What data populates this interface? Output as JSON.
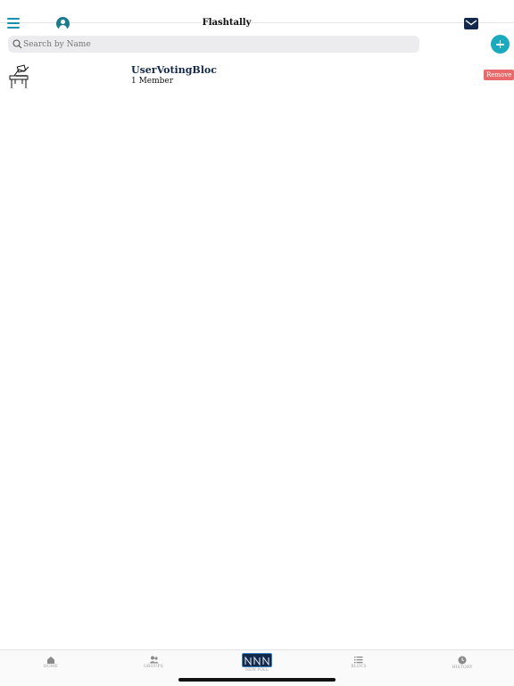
{
  "header": {
    "title": "Flashtally",
    "menu_icon": "hamburger-menu-icon",
    "profile_icon": "profile-icon",
    "mail_icon": "envelope-icon",
    "accent_color": "#1a8fb0",
    "navy_color": "#13294b"
  },
  "search": {
    "placeholder": "Search by Name",
    "value": ""
  },
  "add_button": {
    "icon": "plus-icon",
    "color": "#1ba9bd"
  },
  "blocs": [
    {
      "name": "UserVotingBloc",
      "members": "1 Member",
      "icon": "voting-ballot-box-icon",
      "remove_label": "Remove"
    }
  ],
  "tabbar": {
    "tabs": [
      {
        "label": "HOME",
        "icon": "home-icon"
      },
      {
        "label": "GROUPS",
        "icon": "groups-icon"
      },
      {
        "label": "NEW POLL",
        "icon": "new-poll-logo-icon"
      },
      {
        "label": "BLOCS",
        "icon": "list-icon"
      },
      {
        "label": "HISTORY",
        "icon": "clock-icon"
      }
    ]
  }
}
